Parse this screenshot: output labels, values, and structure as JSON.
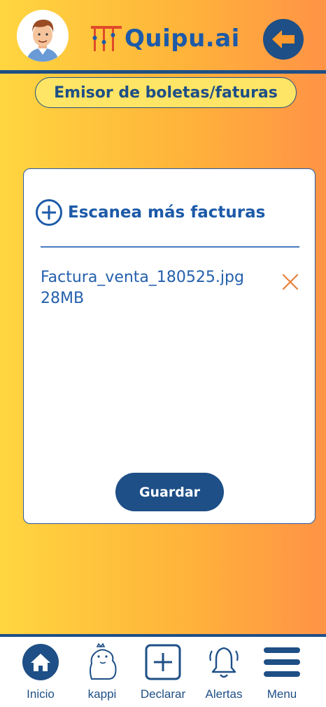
{
  "header": {
    "logo_text": "Quipu.ai",
    "avatar_icon": "user-avatar",
    "back_icon": "arrow-left-icon",
    "brand_color": "#1e4f86",
    "accent_color": "#ff9a2e"
  },
  "section": {
    "title": "Emisor de boletas/faturas"
  },
  "card": {
    "scan_label": "Escanea más facturas",
    "scan_icon": "plus-circle-icon",
    "files": [
      {
        "name": "Factura_venta_180525.jpg",
        "size": "28MB",
        "remove_icon": "close-icon"
      }
    ],
    "save_label": "Guardar"
  },
  "nav": {
    "items": [
      {
        "label": "Inicio",
        "icon": "home-icon"
      },
      {
        "label": "kappi",
        "icon": "capybara-icon"
      },
      {
        "label": "Declarar",
        "icon": "plus-square-icon"
      },
      {
        "label": "Alertas",
        "icon": "bell-icon"
      },
      {
        "label": "Menu",
        "icon": "hamburger-icon"
      }
    ]
  }
}
